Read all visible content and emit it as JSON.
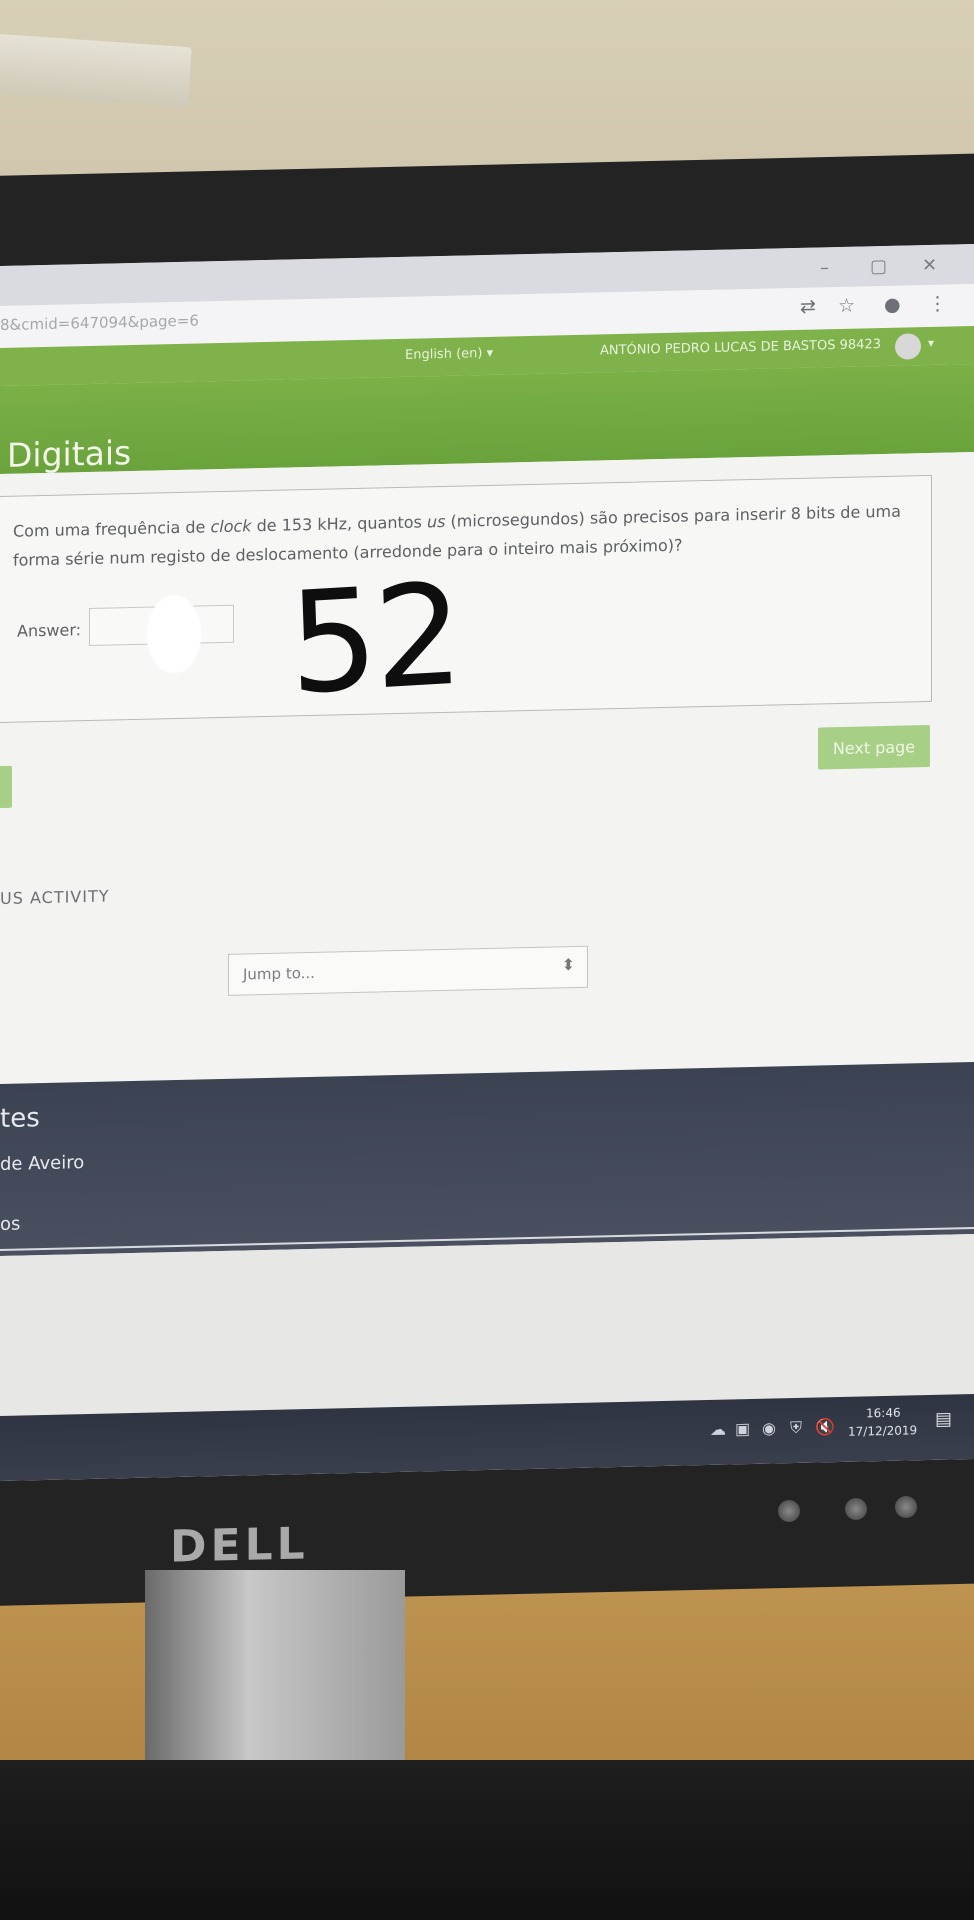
{
  "browser": {
    "url_fragment": "8&cmid=647094&page=6",
    "controls": {
      "minimize": "–",
      "maximize": "▢",
      "close": "✕"
    },
    "icons": [
      "translate-icon",
      "star-icon",
      "profile-icon",
      "menu-icon"
    ]
  },
  "navbar": {
    "language": "English (en) ▾",
    "user_name": "ANTÓNIO PEDRO LUCAS DE BASTOS 98423",
    "user_caret": "▾"
  },
  "page": {
    "course_title": "Digitais"
  },
  "question": {
    "text_part1": "Com uma frequência de ",
    "text_clock": "clock",
    "text_part2": " de 153 kHz, quantos ",
    "text_us": "us",
    "text_part3": " (microsegundos) são precisos para inserir 8 bits de uma forma série num registo de deslocamento (arredonde para o inteiro mais próximo)?",
    "answer_label": "Answer:",
    "answer_value": "",
    "handwritten_answer": "52"
  },
  "navigation": {
    "next_label": "Next page",
    "previous_activity": "US ACTIVITY",
    "jump_placeholder": "Jump to...",
    "jump_caret": "⬍"
  },
  "footer": {
    "heading": "tes",
    "line1": "de Aveiro",
    "line2": "os"
  },
  "taskbar": {
    "time": "16:46",
    "date": "17/12/2019",
    "notification": "▤"
  },
  "monitor": {
    "brand": "DELL"
  },
  "colors": {
    "moodle_green": "#7fb24a",
    "button_green": "#a8cf86",
    "footer_dark": "#3b4251"
  }
}
